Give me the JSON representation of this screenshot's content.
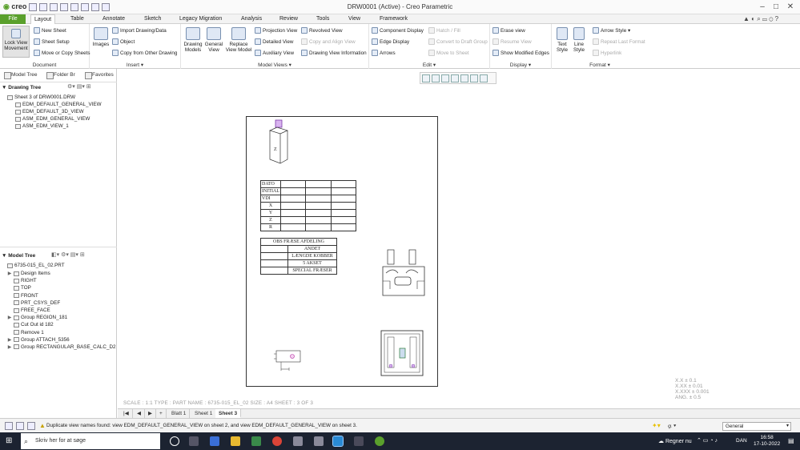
{
  "app": {
    "logo_text": "creo",
    "window_title": "DRW0001 (Active) - Creo Parametric"
  },
  "menu": [
    "File",
    "Layout",
    "Table",
    "Annotate",
    "Sketch",
    "Legacy Migration",
    "Analysis",
    "Review",
    "Tools",
    "View",
    "Framework"
  ],
  "ribbon": {
    "lock_view": "Lock View Movement",
    "doc_items": [
      "New Sheet",
      "Sheet Setup",
      "Move or Copy Sheets"
    ],
    "doc_label": "Document",
    "images": "Images",
    "insert_items": [
      "Import Drawing/Data",
      "Object",
      "Copy from Other Drawing"
    ],
    "insert_label": "Insert ▾",
    "mv_big": [
      "Drawing Models",
      "General View",
      "Replace View Model"
    ],
    "mv_items": [
      "Projection View",
      "Detailed View",
      "Auxiliary View",
      "Revolved View",
      "Copy and Align View",
      "Drawing View Information"
    ],
    "mv_label": "Model Views ▾",
    "edit_items": [
      "Component Display",
      "Edge Display",
      "Arrows",
      "Hatch / Fill",
      "Convert to Draft Group",
      "Move to Sheet"
    ],
    "edit_label": "Edit ▾",
    "display_items": [
      "Erase view",
      "Resume View",
      "Show Modified Edges"
    ],
    "display_label": "Display ▾",
    "format_big": [
      "Text Style",
      "Line Style"
    ],
    "format_items": [
      "Arrow Style ▾",
      "Repeat Last Format",
      "Hyperlink"
    ],
    "format_label": "Format ▾"
  },
  "panel_tabs": [
    "Model Tree",
    "Folder Br",
    "Favorites"
  ],
  "drawing_tree": {
    "title": "Drawing Tree",
    "root": "Sheet 3 of DRW0001.DRW",
    "items": [
      "EDM_DEFAULT_GENERAL_VIEW",
      "EDM_DEFAULT_3D_VIEW",
      "ASM_EDM_GENERAL_VIEW",
      "ASM_EDM_VIEW_1"
    ]
  },
  "model_tree": {
    "title": "Model Tree",
    "root": "6735-015_EL_02.PRT",
    "items": [
      {
        "label": "Design Items",
        "exp": "▶"
      },
      {
        "label": "RIGHT",
        "exp": ""
      },
      {
        "label": "TOP",
        "exp": ""
      },
      {
        "label": "FRONT",
        "exp": ""
      },
      {
        "label": "PRT_CSYS_DEF",
        "exp": ""
      },
      {
        "label": "FREE_FACE",
        "exp": ""
      },
      {
        "label": "Group REGION_181",
        "exp": "▶"
      },
      {
        "label": "Cut Out id 182",
        "exp": ""
      },
      {
        "label": "Remove 1",
        "exp": ""
      },
      {
        "label": "Group ATTACH_5356",
        "exp": "▶"
      },
      {
        "label": "Group RECTANGULAR_BASE_CALC_D2",
        "exp": "▶"
      }
    ]
  },
  "table1": {
    "rows": [
      "DATO",
      "INITIAL",
      "VDI",
      "X",
      "Y",
      "Z",
      "R"
    ]
  },
  "table2": {
    "header": "OBS FRÆSE AFDELING",
    "rows": [
      "ANDET",
      "LÆNGDE KOBBER",
      "5 AKSET",
      "SPECIAL FRÆSER"
    ]
  },
  "part_label": "Z",
  "status_info": "SCALE : 1:1      TYPE : PART     NAME : 6735-015_EL_02     SIZE : A4     SHEET : 3  OF  3",
  "tolerances": [
    "X.X    ± 0.1",
    "X.XX    ± 0.01",
    "X.XXX   ± 0.001",
    "ANG.    ± 0.5"
  ],
  "sheet_tabs": [
    "Blatt 1",
    "Sheet 1",
    "Sheet 3"
  ],
  "status_message": "Duplicate view names found: view EDM_DEFAULT_GENERAL_VIEW on sheet 2, and view EDM_DEFAULT_GENERAL_VIEW on sheet 3.",
  "filter_value": "General",
  "taskbar": {
    "search_placeholder": "Skriv her for at søge",
    "weather": "Regner nu",
    "lang": "DAN",
    "time": "16:58",
    "date": "17-10-2022"
  },
  "colors": {
    "file_tab": "#5aa02c",
    "taskbar": "#1c2331"
  }
}
